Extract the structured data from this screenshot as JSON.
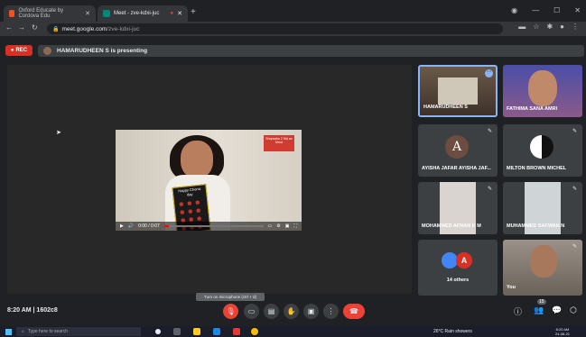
{
  "browser": {
    "tabs": [
      {
        "label": "Oxford Educate by Cordova Edu",
        "color": "#f4511e"
      },
      {
        "label": "Meet - zve-kdxi-juc",
        "color": "#00897b"
      }
    ],
    "url_host": "meet.google.com",
    "url_path": "/zve-kdxi-juc"
  },
  "meet": {
    "rec_label": "REC",
    "presenting_text": "HAMARUDHEEN S is presenting",
    "video": {
      "card_text": "Happy Chorra day",
      "badge_text": "Shopsaka 2 Std as Mrod",
      "time": "0:00 / 0:07",
      "progress": 0.05
    },
    "participants": [
      {
        "id": "ham",
        "name": "HAMARUDHEEN S"
      },
      {
        "id": "amri",
        "name": "FATHIMA SANA AMRI"
      },
      {
        "id": "ayisha",
        "name": "AYISHA JAFAR AYISHA JAF...",
        "avatar_letter": "A"
      },
      {
        "id": "milton",
        "name": "MILTON BROWN MICHEL"
      },
      {
        "id": "mohammed",
        "name": "MOHAMMED AFNAN K M"
      },
      {
        "id": "muhammed",
        "name": "MUHAMMED SAFWAN N"
      },
      {
        "id": "others",
        "name": "14 others",
        "avatar_letter": "A"
      },
      {
        "id": "you",
        "name": "You"
      }
    ],
    "time_code": "8:20 AM  |  1602c8",
    "tooltip": "Turn on microphone (ctrl + d)",
    "people_count": "15"
  },
  "taskbar": {
    "search_placeholder": "Type here to search",
    "weather": "26°C  Rain showers",
    "clock_time": "8:20 AM",
    "clock_date": "24-08-21"
  },
  "colors": {
    "accent": "#8ab4f8",
    "danger": "#ea4335"
  }
}
